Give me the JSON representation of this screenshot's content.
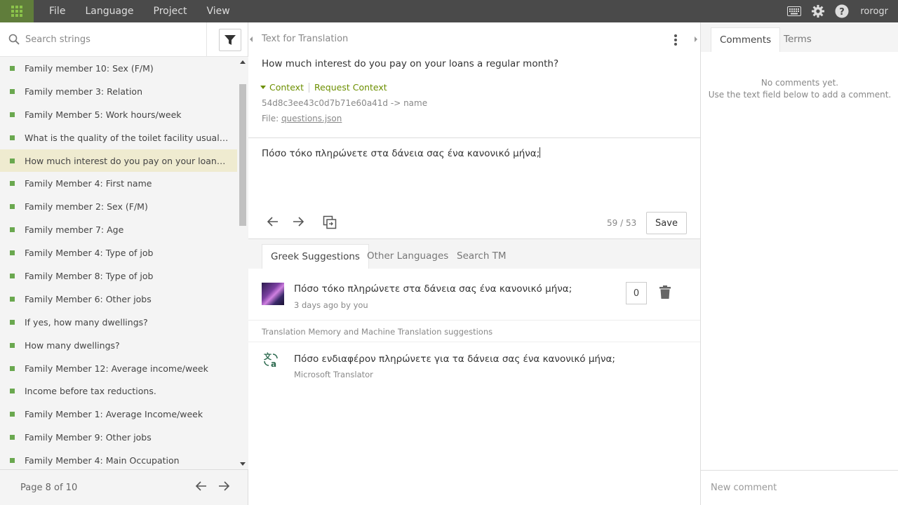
{
  "menu": {
    "items": [
      "File",
      "Language",
      "Project",
      "View"
    ]
  },
  "user": {
    "name": "rorogr"
  },
  "search": {
    "placeholder": "Search strings"
  },
  "strings": [
    "Family member 10: Sex (F/M)",
    "Family member 3: Relation",
    "Family Member 5: Work hours/week",
    "What is the quality of the toilet facility usually used by your household?",
    "How much interest do you pay on your loans a regular month?",
    "Family Member 4: First name",
    "Family member 2: Sex (F/M)",
    "Family member 7: Age",
    "Family Member 4: Type of job",
    "Family Member 8: Type of job",
    "Family Member 6: Other jobs",
    "If yes, how many dwellings?",
    "How many dwellings?",
    "Family Member 12: Average income/week",
    "Income before tax reductions.",
    "Family Member 1: Average Income/week",
    "Family Member 9: Other jobs",
    "Family Member 4: Main Occupation"
  ],
  "active_string_index": 4,
  "pager": {
    "text": "Page 8 of 10"
  },
  "source": {
    "label": "Text for Translation",
    "text": "How much interest do you pay on your loans a regular month?",
    "context_label": "Context",
    "request_context": "Request Context",
    "key": "54d8c3ee43c0d7b71e60a41d -> name",
    "file_prefix": "File: ",
    "file_name": "questions.json"
  },
  "editor": {
    "text": "Πόσο τόκο πληρώνετε στα δάνεια σας ένα κανονικό μήνα;",
    "count": "59 / 53",
    "save_label": "Save"
  },
  "suggestions": {
    "tabs": [
      "Greek Suggestions",
      "Other Languages",
      "Search TM"
    ],
    "items": [
      {
        "text": "Πόσο τόκο πληρώνετε στα δάνεια σας ένα κανονικό μήνα;",
        "meta": "3 days ago by you",
        "votes": "0"
      }
    ],
    "tm_header": "Translation Memory and Machine Translation suggestions",
    "mt": {
      "text": "Πόσο ενδιαφέρον πληρώνετε για τα δάνεια σας ένα κανονικό μήνα;",
      "meta": "Microsoft Translator"
    }
  },
  "comments": {
    "tabs": [
      "Comments",
      "Terms"
    ],
    "empty_line1": "No comments yet.",
    "empty_line2": "Use the text field below to add a comment.",
    "new_placeholder": "New comment"
  },
  "colors": {
    "topbar": "#4a4a4a",
    "accent_green": "#6c8f00",
    "bullet_green": "#6aa84f",
    "active_row": "#efebd0"
  }
}
